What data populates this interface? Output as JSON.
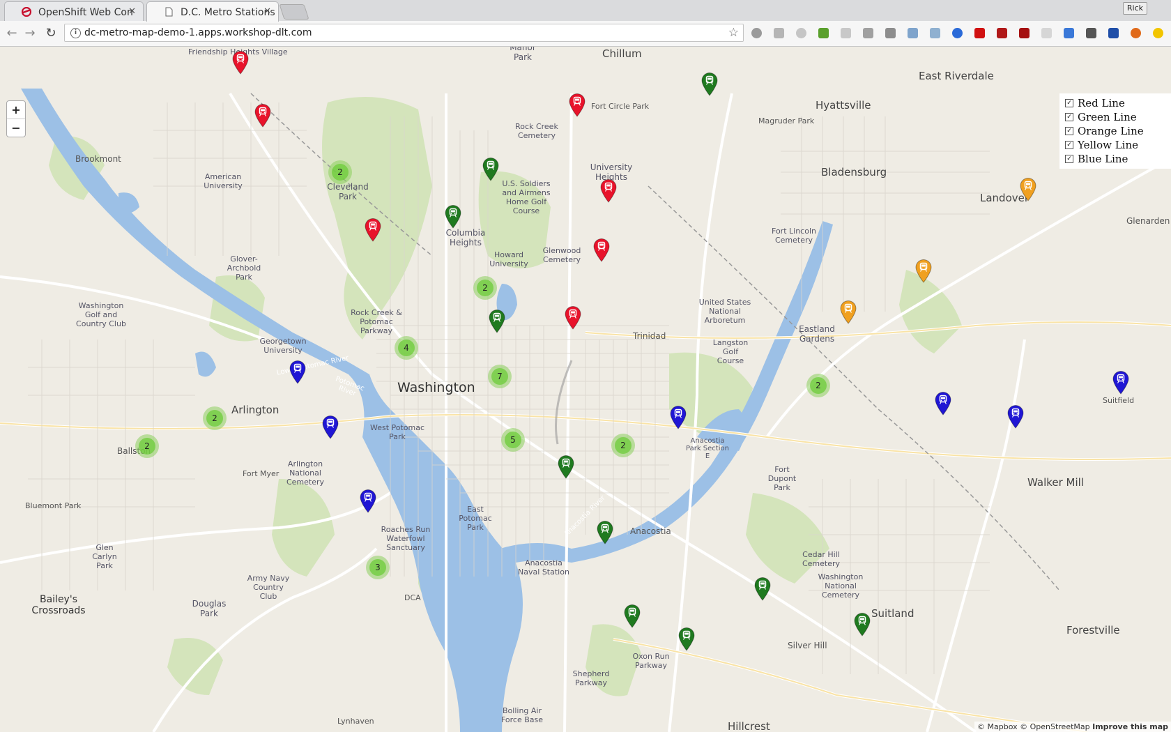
{
  "browser": {
    "tabs": [
      {
        "title": "OpenShift Web Con"
      },
      {
        "title": "D.C. Metro Stations"
      }
    ],
    "url": "dc-metro-map-demo-1.apps.workshop-dlt.com",
    "profile": "Rick"
  },
  "map": {
    "zoom_in": "+",
    "zoom_out": "−",
    "layers": [
      {
        "label": "Red Line",
        "checked": true
      },
      {
        "label": "Green Line",
        "checked": true
      },
      {
        "label": "Orange Line",
        "checked": true
      },
      {
        "label": "Yellow Line",
        "checked": true
      },
      {
        "label": "Blue Line",
        "checked": true
      }
    ],
    "attribution": {
      "mapbox": "© Mapbox",
      "osm": "© OpenStreetMap",
      "improve": "Improve this map"
    },
    "line_colors": {
      "red": "#e8132b",
      "green": "#1f7a1f",
      "orange": "#f0a020",
      "blue": "#2016d4",
      "cluster": "#6ecc39"
    },
    "labels": [
      "Friendship Heights Village",
      "Brookmont",
      "American University",
      "Cleveland Park",
      "Glover-Archbold Park",
      "Washington Golf and Country Club",
      "Georgetown University",
      "Rock Creek & Potomac Parkway",
      "Columbia Heights",
      "Howard University",
      "Manor Park",
      "Chillum",
      "Fort Circle Park",
      "Rock Creek Cemetery",
      "U.S. Soldiers and Airmens Home Golf Course",
      "University Heights",
      "Glenwood Cemetery",
      "Hyattsville",
      "East Riverdale",
      "Magruder Park",
      "Bladensburg",
      "Fort Lincoln Cemetery",
      "Landover",
      "Glenarden",
      "United States National Arboretum",
      "Langston Golf Course",
      "Trinidad",
      "Eastland Gardens",
      "Washington",
      "Arlington",
      "West Potomac Park",
      "Ballston",
      "Arlington National Cemetery",
      "Fort Myer",
      "Bluemont Park",
      "Glen Carlyn Park",
      "Army Navy Country Club",
      "Douglas Park",
      "Bailey's Crossroads",
      "Roaches Run Waterfowl Sanctuary",
      "East Potomac Park",
      "DCA",
      "Anacostia Naval Station",
      "Anacostia",
      "Fort Dupont Park",
      "Cedar Hill Cemetery",
      "Washington National Cemetery",
      "Suitland",
      "Silver Hill",
      "Forestville",
      "Walker Mill",
      "Shepherd Parkway",
      "Oxon Run Parkway",
      "Bolling Air Force Base",
      "Lynhaven",
      "Hillcrest",
      "Suitfield",
      "Anacostia Park Section E",
      "Potomac River",
      "Lower Potomac River",
      "Anacostia River"
    ],
    "clusters": [
      2,
      2,
      4,
      7,
      2,
      2,
      5,
      2,
      2,
      3
    ],
    "markers": [
      {
        "line": "red"
      },
      {
        "line": "red"
      },
      {
        "line": "red"
      },
      {
        "line": "red"
      },
      {
        "line": "red"
      },
      {
        "line": "red"
      },
      {
        "line": "red"
      },
      {
        "line": "green"
      },
      {
        "line": "green"
      },
      {
        "line": "green"
      },
      {
        "line": "green"
      },
      {
        "line": "green"
      },
      {
        "line": "green"
      },
      {
        "line": "green"
      },
      {
        "line": "green"
      },
      {
        "line": "green"
      },
      {
        "line": "green"
      },
      {
        "line": "orange"
      },
      {
        "line": "orange"
      },
      {
        "line": "orange"
      },
      {
        "line": "orange"
      },
      {
        "line": "blue"
      },
      {
        "line": "blue"
      },
      {
        "line": "blue"
      },
      {
        "line": "blue"
      },
      {
        "line": "blue"
      },
      {
        "line": "blue"
      },
      {
        "line": "blue"
      }
    ]
  }
}
